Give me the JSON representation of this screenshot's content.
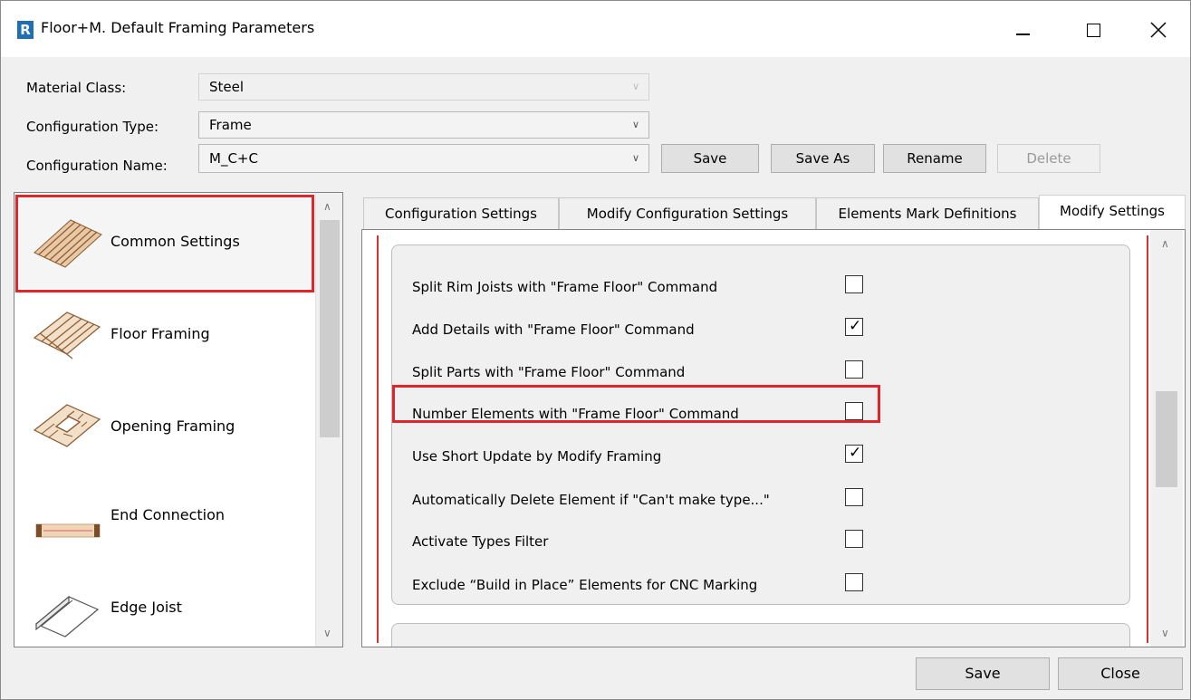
{
  "window": {
    "title": "Floor+M. Default Framing Parameters",
    "logo": "R"
  },
  "header": {
    "material_class_label": "Material Class:",
    "material_class_value": "Steel",
    "configuration_type_label": "Configuration Type:",
    "configuration_type_value": "Frame",
    "configuration_name_label": "Configuration Name:",
    "configuration_name_value": "M_C+C",
    "save_label": "Save",
    "save_as_label": "Save As",
    "rename_label": "Rename",
    "delete_label": "Delete"
  },
  "sidebar": {
    "items": [
      {
        "label": "Common Settings",
        "icon": "floor-deck-icon"
      },
      {
        "label": "Floor Framing",
        "icon": "floor-framing-icon"
      },
      {
        "label": "Opening Framing",
        "icon": "opening-framing-icon"
      },
      {
        "label": "End Connection",
        "icon": "end-connection-icon"
      },
      {
        "label": "Edge Joist",
        "icon": "edge-joist-icon"
      }
    ]
  },
  "tabs": [
    {
      "label": "Configuration Settings"
    },
    {
      "label": "Modify Configuration Settings"
    },
    {
      "label": "Elements Mark Definitions"
    },
    {
      "label": "Modify Settings"
    }
  ],
  "settings": [
    {
      "label": "Split Rim Joists with \"Frame Floor\" Command",
      "checked": false
    },
    {
      "label": "Add Details with \"Frame Floor\" Command",
      "checked": true
    },
    {
      "label": "Split Parts with \"Frame Floor\" Command",
      "checked": false
    },
    {
      "label": "Number Elements with \"Frame Floor\" Command",
      "checked": false
    },
    {
      "label": "Use Short Update by Modify Framing",
      "checked": true
    },
    {
      "label": "Automatically Delete Element if \"Can't make type...\"",
      "checked": false
    },
    {
      "label": "Activate Types Filter",
      "checked": false
    },
    {
      "label": "Exclude “Build in Place” Elements for CNC Marking",
      "checked": false
    }
  ],
  "footer": {
    "save_label": "Save",
    "close_label": "Close"
  },
  "colors": {
    "highlight": "#e0262a",
    "wood": "#c98a55"
  }
}
